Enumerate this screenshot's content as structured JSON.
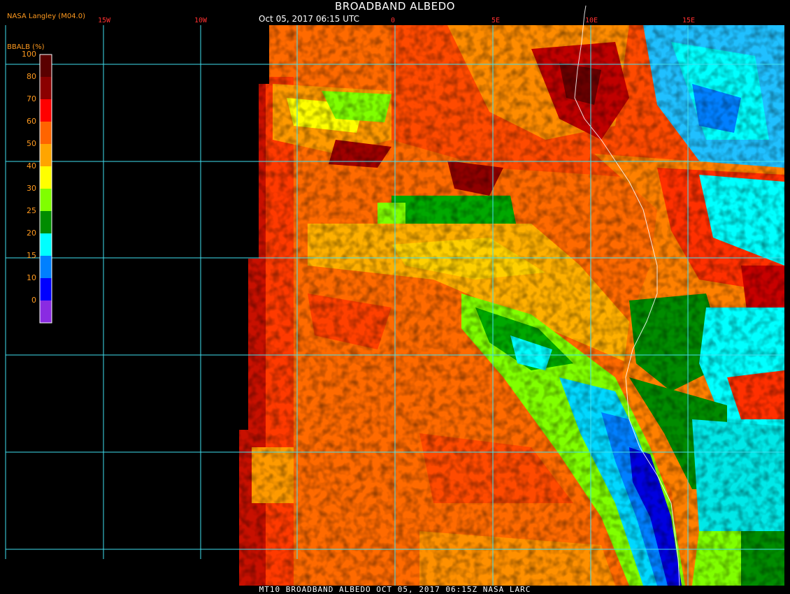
{
  "title": "BROADBAND ALBEDO",
  "subtitle": "Oct 05, 2017 06:15 UTC",
  "credit": "NASA Langley (M04.0)",
  "footer": "MT10  BROADBAND ALBEDO   OCT 05, 2017 06:15Z   NASA LARC",
  "longitude_labels": [
    "15W",
    "10W",
    "0",
    "5E",
    "10E",
    "15E"
  ],
  "legend": {
    "title": "BBALB (%)",
    "ticks": [
      "100",
      "80",
      "70",
      "60",
      "50",
      "40",
      "30",
      "25",
      "20",
      "15",
      "10",
      "0"
    ],
    "colors": [
      "#5a0000",
      "#8b0000",
      "#ff0000",
      "#ff6400",
      "#ffa500",
      "#ffff00",
      "#80ff00",
      "#008c00",
      "#00ffff",
      "#0080ff",
      "#0000ff",
      "#8a2be2"
    ]
  },
  "colors": {
    "grid": "#40e0f0",
    "land_border": "#ffffff",
    "background": "#000000"
  }
}
